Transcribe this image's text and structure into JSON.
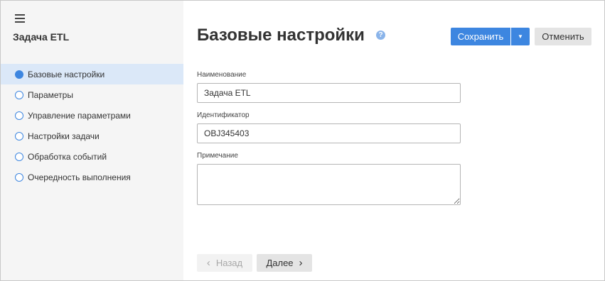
{
  "sidebar": {
    "menu_icon": "hamburger-icon",
    "title": "Задача ETL",
    "items": [
      {
        "label": "Базовые настройки",
        "active": true
      },
      {
        "label": "Параметры",
        "active": false
      },
      {
        "label": "Управление параметрами",
        "active": false
      },
      {
        "label": "Настройки задачи",
        "active": false
      },
      {
        "label": "Обработка событий",
        "active": false
      },
      {
        "label": "Очередность выполнения",
        "active": false
      }
    ]
  },
  "header": {
    "title": "Базовые настройки",
    "help_icon": "question-circle-icon",
    "save_label": "Сохранить",
    "save_dropdown_icon": "caret-down-icon",
    "cancel_label": "Отменить"
  },
  "form": {
    "name": {
      "label": "Наименование",
      "value": "Задача ETL"
    },
    "identifier": {
      "label": "Идентификатор",
      "value": "OBJ345403"
    },
    "note": {
      "label": "Примечание",
      "value": ""
    }
  },
  "footer": {
    "back_label": "Назад",
    "back_icon": "chevron-left-icon",
    "next_label": "Далее",
    "next_icon": "chevron-right-icon"
  },
  "colors": {
    "accent": "#3d86e0",
    "sidebar_bg": "#f5f5f5",
    "active_item_bg": "#dbe8f8"
  }
}
